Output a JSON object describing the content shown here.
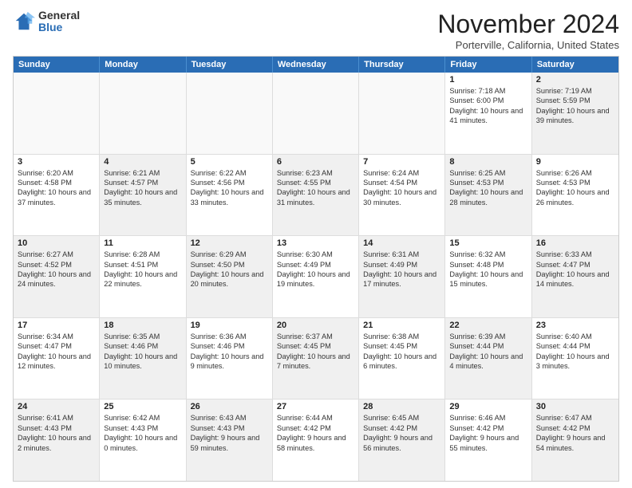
{
  "logo": {
    "general": "General",
    "blue": "Blue"
  },
  "title": {
    "month": "November 2024",
    "location": "Porterville, California, United States"
  },
  "headers": [
    "Sunday",
    "Monday",
    "Tuesday",
    "Wednesday",
    "Thursday",
    "Friday",
    "Saturday"
  ],
  "weeks": [
    [
      {
        "day": "",
        "info": "",
        "empty": true
      },
      {
        "day": "",
        "info": "",
        "empty": true
      },
      {
        "day": "",
        "info": "",
        "empty": true
      },
      {
        "day": "",
        "info": "",
        "empty": true
      },
      {
        "day": "",
        "info": "",
        "empty": true
      },
      {
        "day": "1",
        "info": "Sunrise: 7:18 AM\nSunset: 6:00 PM\nDaylight: 10 hours and 41 minutes.",
        "empty": false
      },
      {
        "day": "2",
        "info": "Sunrise: 7:19 AM\nSunset: 5:59 PM\nDaylight: 10 hours and 39 minutes.",
        "empty": false,
        "shaded": true
      }
    ],
    [
      {
        "day": "3",
        "info": "Sunrise: 6:20 AM\nSunset: 4:58 PM\nDaylight: 10 hours and 37 minutes.",
        "empty": false
      },
      {
        "day": "4",
        "info": "Sunrise: 6:21 AM\nSunset: 4:57 PM\nDaylight: 10 hours and 35 minutes.",
        "empty": false,
        "shaded": true
      },
      {
        "day": "5",
        "info": "Sunrise: 6:22 AM\nSunset: 4:56 PM\nDaylight: 10 hours and 33 minutes.",
        "empty": false
      },
      {
        "day": "6",
        "info": "Sunrise: 6:23 AM\nSunset: 4:55 PM\nDaylight: 10 hours and 31 minutes.",
        "empty": false,
        "shaded": true
      },
      {
        "day": "7",
        "info": "Sunrise: 6:24 AM\nSunset: 4:54 PM\nDaylight: 10 hours and 30 minutes.",
        "empty": false
      },
      {
        "day": "8",
        "info": "Sunrise: 6:25 AM\nSunset: 4:53 PM\nDaylight: 10 hours and 28 minutes.",
        "empty": false,
        "shaded": true
      },
      {
        "day": "9",
        "info": "Sunrise: 6:26 AM\nSunset: 4:53 PM\nDaylight: 10 hours and 26 minutes.",
        "empty": false
      }
    ],
    [
      {
        "day": "10",
        "info": "Sunrise: 6:27 AM\nSunset: 4:52 PM\nDaylight: 10 hours and 24 minutes.",
        "empty": false,
        "shaded": true
      },
      {
        "day": "11",
        "info": "Sunrise: 6:28 AM\nSunset: 4:51 PM\nDaylight: 10 hours and 22 minutes.",
        "empty": false
      },
      {
        "day": "12",
        "info": "Sunrise: 6:29 AM\nSunset: 4:50 PM\nDaylight: 10 hours and 20 minutes.",
        "empty": false,
        "shaded": true
      },
      {
        "day": "13",
        "info": "Sunrise: 6:30 AM\nSunset: 4:49 PM\nDaylight: 10 hours and 19 minutes.",
        "empty": false
      },
      {
        "day": "14",
        "info": "Sunrise: 6:31 AM\nSunset: 4:49 PM\nDaylight: 10 hours and 17 minutes.",
        "empty": false,
        "shaded": true
      },
      {
        "day": "15",
        "info": "Sunrise: 6:32 AM\nSunset: 4:48 PM\nDaylight: 10 hours and 15 minutes.",
        "empty": false
      },
      {
        "day": "16",
        "info": "Sunrise: 6:33 AM\nSunset: 4:47 PM\nDaylight: 10 hours and 14 minutes.",
        "empty": false,
        "shaded": true
      }
    ],
    [
      {
        "day": "17",
        "info": "Sunrise: 6:34 AM\nSunset: 4:47 PM\nDaylight: 10 hours and 12 minutes.",
        "empty": false
      },
      {
        "day": "18",
        "info": "Sunrise: 6:35 AM\nSunset: 4:46 PM\nDaylight: 10 hours and 10 minutes.",
        "empty": false,
        "shaded": true
      },
      {
        "day": "19",
        "info": "Sunrise: 6:36 AM\nSunset: 4:46 PM\nDaylight: 10 hours and 9 minutes.",
        "empty": false
      },
      {
        "day": "20",
        "info": "Sunrise: 6:37 AM\nSunset: 4:45 PM\nDaylight: 10 hours and 7 minutes.",
        "empty": false,
        "shaded": true
      },
      {
        "day": "21",
        "info": "Sunrise: 6:38 AM\nSunset: 4:45 PM\nDaylight: 10 hours and 6 minutes.",
        "empty": false
      },
      {
        "day": "22",
        "info": "Sunrise: 6:39 AM\nSunset: 4:44 PM\nDaylight: 10 hours and 4 minutes.",
        "empty": false,
        "shaded": true
      },
      {
        "day": "23",
        "info": "Sunrise: 6:40 AM\nSunset: 4:44 PM\nDaylight: 10 hours and 3 minutes.",
        "empty": false
      }
    ],
    [
      {
        "day": "24",
        "info": "Sunrise: 6:41 AM\nSunset: 4:43 PM\nDaylight: 10 hours and 2 minutes.",
        "empty": false,
        "shaded": true
      },
      {
        "day": "25",
        "info": "Sunrise: 6:42 AM\nSunset: 4:43 PM\nDaylight: 10 hours and 0 minutes.",
        "empty": false
      },
      {
        "day": "26",
        "info": "Sunrise: 6:43 AM\nSunset: 4:43 PM\nDaylight: 9 hours and 59 minutes.",
        "empty": false,
        "shaded": true
      },
      {
        "day": "27",
        "info": "Sunrise: 6:44 AM\nSunset: 4:42 PM\nDaylight: 9 hours and 58 minutes.",
        "empty": false
      },
      {
        "day": "28",
        "info": "Sunrise: 6:45 AM\nSunset: 4:42 PM\nDaylight: 9 hours and 56 minutes.",
        "empty": false,
        "shaded": true
      },
      {
        "day": "29",
        "info": "Sunrise: 6:46 AM\nSunset: 4:42 PM\nDaylight: 9 hours and 55 minutes.",
        "empty": false
      },
      {
        "day": "30",
        "info": "Sunrise: 6:47 AM\nSunset: 4:42 PM\nDaylight: 9 hours and 54 minutes.",
        "empty": false,
        "shaded": true
      }
    ]
  ]
}
